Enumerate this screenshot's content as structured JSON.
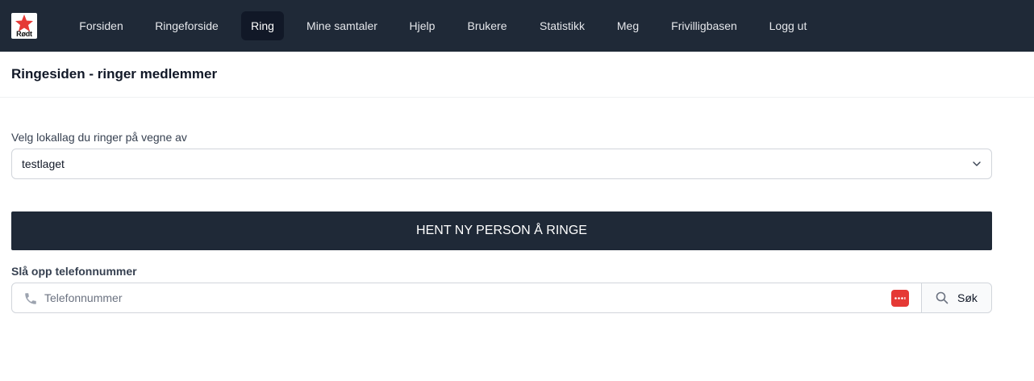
{
  "nav": {
    "logo_text": "Rødt",
    "items": [
      {
        "label": "Forsiden",
        "active": false
      },
      {
        "label": "Ringeforside",
        "active": false
      },
      {
        "label": "Ring",
        "active": true
      },
      {
        "label": "Mine samtaler",
        "active": false
      },
      {
        "label": "Hjelp",
        "active": false
      },
      {
        "label": "Brukere",
        "active": false
      },
      {
        "label": "Statistikk",
        "active": false
      },
      {
        "label": "Meg",
        "active": false
      },
      {
        "label": "Frivilligbasen",
        "active": false
      },
      {
        "label": "Logg ut",
        "active": false
      }
    ]
  },
  "page": {
    "title": "Ringesiden - ringer medlemmer"
  },
  "team_select": {
    "label": "Velg lokallag du ringer på vegne av",
    "selected": "testlaget"
  },
  "fetch_button": {
    "label": "HENT NY PERSON Å RINGE"
  },
  "phone_lookup": {
    "label": "Slå opp telefonnummer",
    "placeholder": "Telefonnummer",
    "value": "",
    "search_label": "Søk"
  },
  "icons": {
    "logo": "rodt-star-logo",
    "select": "chevron-down-icon",
    "phone": "phone-icon",
    "password_manager": "password-manager-icon",
    "search": "search-icon"
  },
  "colors": {
    "navbar_bg": "#1f2937",
    "active_nav_bg": "#111827",
    "button_bg": "#1f2937",
    "brand_red": "#e53935"
  }
}
